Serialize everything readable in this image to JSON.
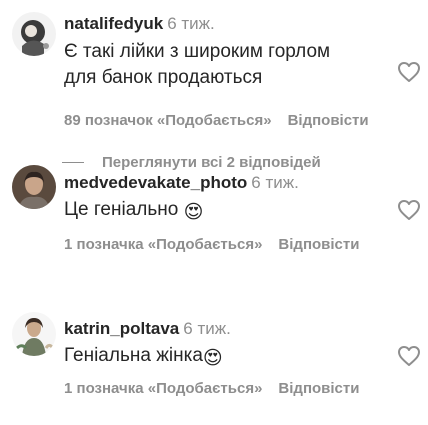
{
  "comments": [
    {
      "username": "natalifedyuk",
      "time": "6 тиж.",
      "text_line1": "Є такі лійки з широким горлом",
      "text_line2": "для банок продаються",
      "likes": "89 позначок «Подобається»",
      "reply": "Відповісти",
      "avatar_icon": "avatar-natalifedyuk"
    },
    {
      "username": "medvedevakate_photo",
      "time": "6 тиж.",
      "text": "Це геніально",
      "emoji": "😍",
      "likes": "1 позначка «Подобається»",
      "reply": "Відповісти",
      "avatar_icon": "avatar-medvedevakate"
    },
    {
      "username": "katrin_poltava",
      "time": "6 тиж.",
      "text": "Геніальна жінка",
      "emoji": "😍",
      "likes": "1 позначка «Подобається»",
      "reply": "Відповісти",
      "avatar_icon": "avatar-katrin"
    }
  ],
  "view_replies": "Переглянути всі 2 відповідей",
  "colors": {
    "text_primary": "#262626",
    "text_secondary": "#8e8e8e"
  }
}
